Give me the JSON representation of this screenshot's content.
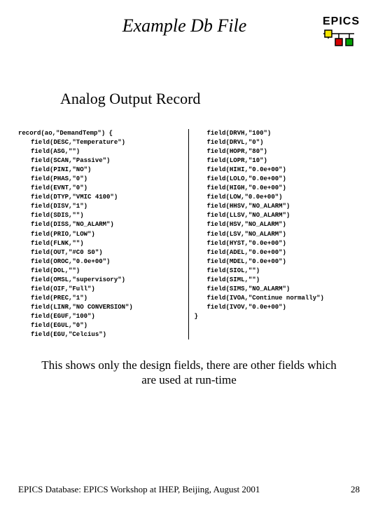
{
  "header": {
    "title": "Example Db File",
    "logo_text": "EPICS"
  },
  "subtitle": "Analog Output Record",
  "code": {
    "record_line": "record(ao,\"DemandTemp\") {",
    "left": [
      "field(DESC,\"Temperature\")",
      "field(ASG,\"\")",
      "field(SCAN,\"Passive\")",
      "field(PINI,\"NO\")",
      "field(PHAS,\"0\")",
      "field(EVNT,\"0\")",
      "field(DTYP,\"VMIC 4100\")",
      "field(DISV,\"1\")",
      "field(SDIS,\"\")",
      "field(DISS,\"NO_ALARM\")",
      "field(PRIO,\"LOW\")",
      "field(FLNK,\"\")",
      "field(OUT,\"#C0 S0\")",
      "field(OROC,\"0.0e+00\")",
      "field(DOL,\"\")",
      "field(OMSL,\"supervisory\")",
      "field(OIF,\"Full\")",
      "field(PREC,\"1\")",
      "field(LINR,\"NO CONVERSION\")",
      "field(EGUF,\"100\")",
      "field(EGUL,\"0\")",
      "field(EGU,\"Celcius\")"
    ],
    "right": [
      "field(DRVH,\"100\")",
      "field(DRVL,\"0\")",
      "field(HOPR,\"80\")",
      "field(LOPR,\"10\")",
      "field(HIHI,\"0.0e+00\")",
      "field(LOLO,\"0.0e+00\")",
      "field(HIGH,\"0.0e+00\")",
      "field(LOW,\"0.0e+00\")",
      "field(HHSV,\"NO_ALARM\")",
      "field(LLSV,\"NO_ALARM\")",
      "field(HSV,\"NO_ALARM\")",
      "field(LSV,\"NO_ALARM\")",
      "field(HYST,\"0.0e+00\")",
      "field(ADEL,\"0.0e+00\")",
      "field(MDEL,\"0.0e+00\")",
      "field(SIOL,\"\")",
      "field(SIML,\"\")",
      "field(SIMS,\"NO_ALARM\")",
      "field(IVOA,\"Continue normally\")",
      "field(IVOV,\"0.0e+00\")"
    ],
    "close": "}"
  },
  "note": "This shows only the design fields, there are other fields which are used at run-time",
  "footer": {
    "text": "EPICS Database: EPICS Workshop at IHEP, Beijing, August 2001",
    "page": "28"
  }
}
